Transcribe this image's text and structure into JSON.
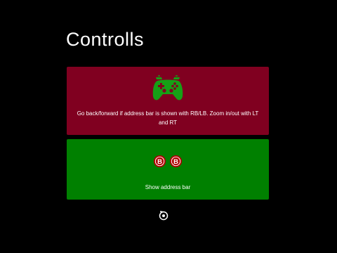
{
  "page": {
    "title": "Controlls"
  },
  "cards": [
    {
      "description": "Go back/forward if address bar is shown with RB/LB. Zoom in/out with LT and RT",
      "icon": "gamepad-icon",
      "background": "#800020",
      "icon_color": "#16a016"
    },
    {
      "description": "Show address bar",
      "icon": "b-button-icon",
      "glyph_label": "B",
      "background": "#008000",
      "icon_color": "#b00000"
    }
  ],
  "footer": {
    "icon": "cursor-target-icon"
  }
}
